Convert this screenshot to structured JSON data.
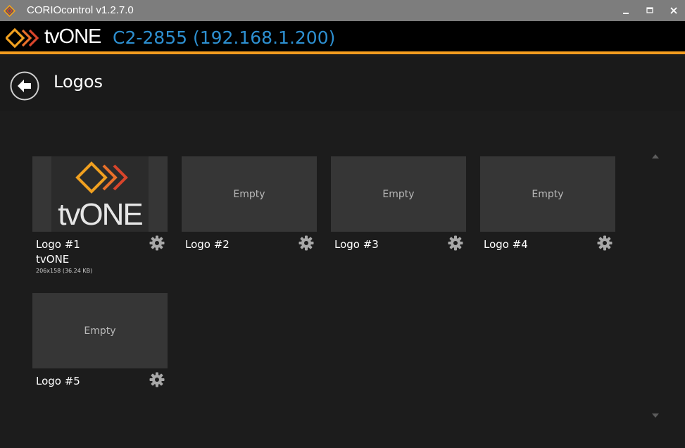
{
  "window": {
    "title": "CORIOcontrol v1.2.7.0"
  },
  "brand": {
    "name": "tvONE",
    "device": "C2-2855 (192.168.1.200)"
  },
  "header": {
    "title": "Logos"
  },
  "logos": [
    {
      "name": "Logo #1",
      "subtitle": "tvONE",
      "meta": "206x158 (36.24 KB)",
      "empty_label": "",
      "has_image": true
    },
    {
      "name": "Logo #2",
      "subtitle": "",
      "meta": "",
      "empty_label": "Empty",
      "has_image": false
    },
    {
      "name": "Logo #3",
      "subtitle": "",
      "meta": "",
      "empty_label": "Empty",
      "has_image": false
    },
    {
      "name": "Logo #4",
      "subtitle": "",
      "meta": "",
      "empty_label": "Empty",
      "has_image": false
    },
    {
      "name": "Logo #5",
      "subtitle": "",
      "meta": "",
      "empty_label": "Empty",
      "has_image": false
    }
  ],
  "thumb_logo": {
    "text": "tvONE"
  },
  "icons": {
    "app": "corio-app-icon",
    "back": "back-arrow-icon",
    "settings": "gear-icon",
    "scroll_up": "chevron-up-icon",
    "scroll_down": "chevron-down-icon"
  },
  "colors": {
    "accent_orange": "#f39c1f",
    "device_blue": "#2d8fd0",
    "logo_orange": "#f0a020",
    "logo_red": "#d9452b"
  }
}
